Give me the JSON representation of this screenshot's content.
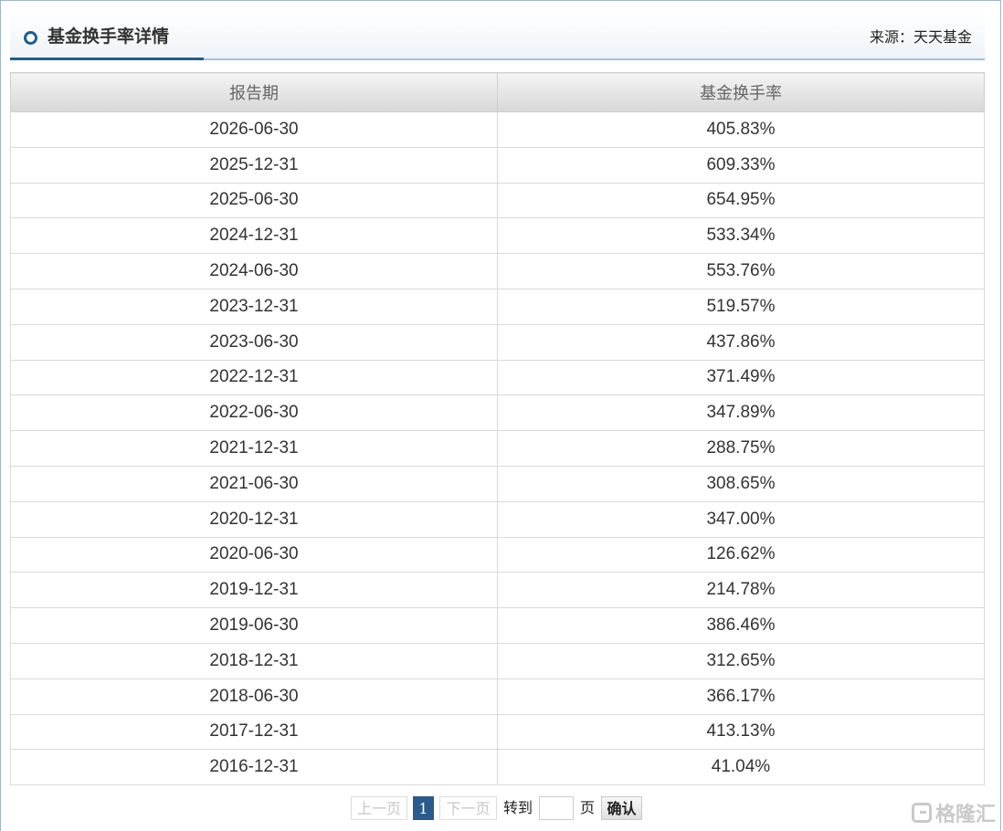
{
  "panel": {
    "title": "基金换手率详情",
    "source": "来源：天天基金"
  },
  "table": {
    "headers": [
      "报告期",
      "基金换手率"
    ],
    "rows": [
      [
        "2026-06-30",
        "405.83%"
      ],
      [
        "2025-12-31",
        "609.33%"
      ],
      [
        "2025-06-30",
        "654.95%"
      ],
      [
        "2024-12-31",
        "533.34%"
      ],
      [
        "2024-06-30",
        "553.76%"
      ],
      [
        "2023-12-31",
        "519.57%"
      ],
      [
        "2023-06-30",
        "437.86%"
      ],
      [
        "2022-12-31",
        "371.49%"
      ],
      [
        "2022-06-30",
        "347.89%"
      ],
      [
        "2021-12-31",
        "288.75%"
      ],
      [
        "2021-06-30",
        "308.65%"
      ],
      [
        "2020-12-31",
        "347.00%"
      ],
      [
        "2020-06-30",
        "126.62%"
      ],
      [
        "2019-12-31",
        "214.78%"
      ],
      [
        "2019-06-30",
        "386.46%"
      ],
      [
        "2018-12-31",
        "312.65%"
      ],
      [
        "2018-06-30",
        "366.17%"
      ],
      [
        "2017-12-31",
        "413.13%"
      ],
      [
        "2016-12-31",
        "41.04%"
      ]
    ]
  },
  "pager": {
    "prev_label": "上一页",
    "current_page": "1",
    "next_label": "下一页",
    "goto_label": "转到",
    "page_unit": "页",
    "jump_value": "",
    "confirm_label": "确认"
  },
  "watermark": {
    "text": "格隆汇",
    "icon": "gelonghui-logo-icon"
  },
  "colors": {
    "accent": "#1f5f8b",
    "current_page_bg": "#2b5a8c"
  }
}
